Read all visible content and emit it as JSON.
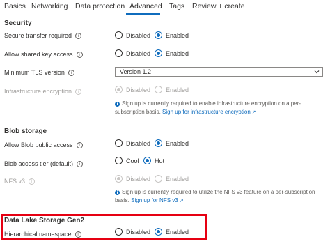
{
  "tabs": [
    "Basics",
    "Networking",
    "Data protection",
    "Advanced",
    "Tags",
    "Review + create"
  ],
  "active_tab": "Advanced",
  "security": {
    "title": "Security",
    "secure_transfer": {
      "label": "Secure transfer required",
      "options": [
        "Disabled",
        "Enabled"
      ],
      "selected": "Enabled"
    },
    "shared_key": {
      "label": "Allow shared key access",
      "options": [
        "Disabled",
        "Enabled"
      ],
      "selected": "Enabled"
    },
    "tls": {
      "label": "Minimum TLS version",
      "value": "Version 1.2"
    },
    "infra_encryption": {
      "label": "Infrastructure encryption",
      "options": [
        "Disabled",
        "Enabled"
      ],
      "selected": "Disabled",
      "note_text_1": "Sign up is currently required to enable infrastructure encryption on a per-",
      "note_text_2": "subscription basis.",
      "note_link": "Sign up for infrastructure encryption"
    }
  },
  "blob": {
    "title": "Blob storage",
    "public_access": {
      "label": "Allow Blob public access",
      "options": [
        "Disabled",
        "Enabled"
      ],
      "selected": "Enabled"
    },
    "access_tier": {
      "label": "Blob access tier (default)",
      "options": [
        "Cool",
        "Hot"
      ],
      "selected": "Hot"
    },
    "nfs": {
      "label": "NFS v3",
      "options": [
        "Disabled",
        "Enabled"
      ],
      "selected": "Disabled",
      "note_text_1": "Sign up is currently required to utilize the NFS v3 feature on a per-subscription",
      "note_text_2": "basis.",
      "note_link": "Sign up for NFS v3"
    }
  },
  "datalake": {
    "title": "Data Lake Storage Gen2",
    "hns": {
      "label": "Hierarchical namespace",
      "options": [
        "Disabled",
        "Enabled"
      ],
      "selected": "Enabled"
    }
  },
  "colors": {
    "accent": "#0f6cbd",
    "highlight": "#e60012"
  },
  "icons": {
    "info": "info-icon",
    "external": "external-link-icon",
    "chevron": "chevron-down-icon"
  }
}
